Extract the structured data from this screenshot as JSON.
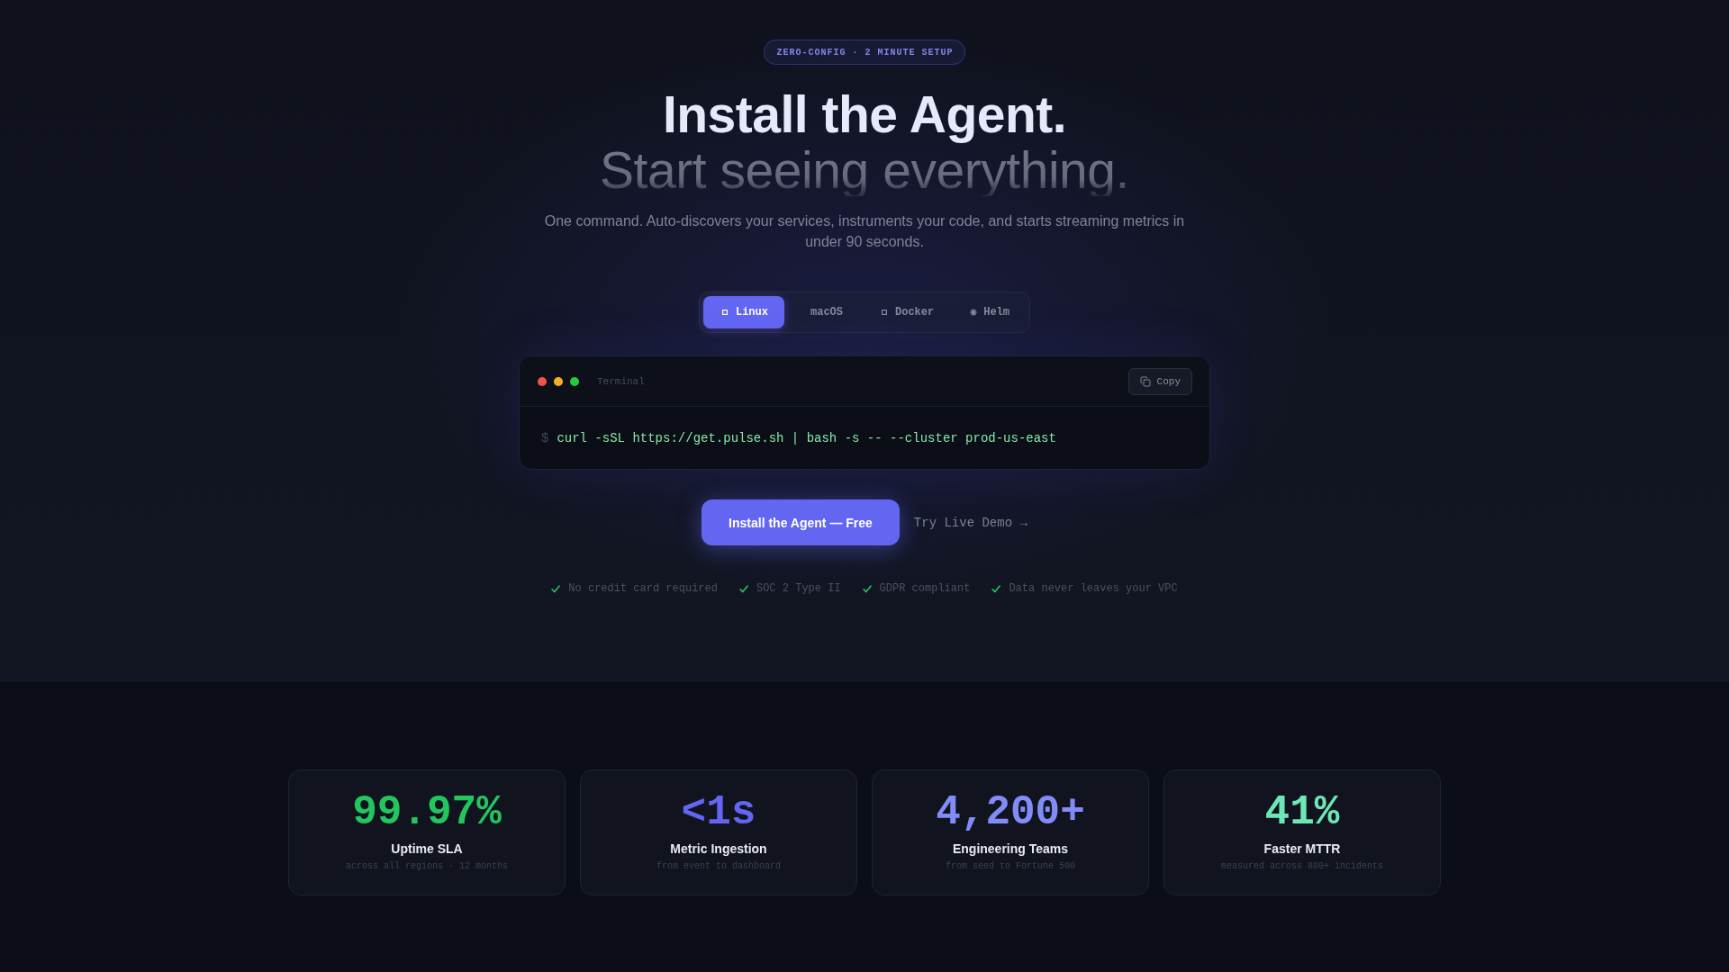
{
  "badge": "ZERO-CONFIG · 2 MINUTE SETUP",
  "hero": {
    "title": "Install the Agent.",
    "subtitle": "Start seeing everything.",
    "description": "One command. Auto-discovers your services, instruments your code, and starts streaming metrics in under 90 seconds."
  },
  "platform_tabs": [
    {
      "label": "Linux",
      "kind": "square",
      "selected": true
    },
    {
      "label": "macOS",
      "kind": "plain",
      "selected": false
    },
    {
      "label": "Docker",
      "kind": "square",
      "selected": false
    },
    {
      "label": "Helm",
      "kind": "wheel",
      "selected": false
    }
  ],
  "terminal": {
    "title": "Terminal",
    "copy_button": "Copy",
    "prompt": "$",
    "command": "curl -sSL https://get.pulse.sh | bash -s -- --cluster prod-us-east"
  },
  "actions": {
    "primary": "Install the Agent — Free",
    "secondary": "Try Live Demo →"
  },
  "assurances": [
    "No credit card required",
    "SOC 2 Type II",
    "GDPR compliant",
    "Data never leaves your VPC"
  ],
  "stats": [
    {
      "value": "99.97%",
      "label": "Uptime SLA",
      "note": "across all regions · 12 months",
      "color": "#22c55e"
    },
    {
      "value": "<1s",
      "label": "Metric Ingestion",
      "note": "from event to dashboard",
      "color": "#6366f1"
    },
    {
      "value": "4,200+",
      "label": "Engineering Teams",
      "note": "from seed to Fortune 500",
      "color": "#818cf8"
    },
    {
      "value": "41%",
      "label": "Faster MTTR",
      "note": "measured across 800+ incidents",
      "color": "#6ee7b7"
    }
  ]
}
